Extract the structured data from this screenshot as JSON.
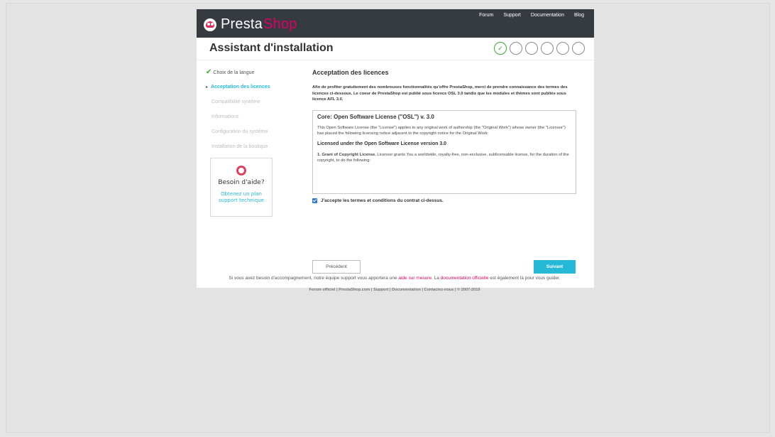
{
  "brand": {
    "presta": "Presta",
    "shop": "Shop"
  },
  "toplinks": [
    "Forum",
    "Support",
    "Documentation",
    "Blog"
  ],
  "page_title": "Assistant d'installation",
  "steps_total": 6,
  "steps_done": 1,
  "sidebar": {
    "items": [
      {
        "label": "Choix de la langue",
        "state": "done"
      },
      {
        "label": "Acceptation des licences",
        "state": "active"
      },
      {
        "label": "Compatibilité système",
        "state": "pending"
      },
      {
        "label": "Informations",
        "state": "pending"
      },
      {
        "label": "Configuration du système",
        "state": "pending"
      },
      {
        "label": "Installation de la boutique",
        "state": "pending"
      }
    ]
  },
  "help": {
    "heading": "Besoin d'aide?",
    "link": "Obtenez un plan support technique"
  },
  "main": {
    "heading": "Acceptation des licences",
    "intro": "Afin de profiter gratuitement des nombreuses fonctionnalités qu'offre PrestaShop, merci de prendre connaissance des termes des licences ci-dessous. Le coeur de PrestaShop est publié sous licence OSL 3.0 tandis que les modules et thèmes sont publiés sous licence AFL 3.0."
  },
  "license": {
    "title": "Core: Open Software License (\"OSL\") v. 3.0",
    "para1": "This Open Software License (the \"License\") applies to any original work of authorship (the \"Original Work\") whose owner (the \"Licensor\") has placed the following licensing notice adjacent to the copyright notice for the Original Work:",
    "subhead": "Licensed under the Open Software License version 3.0",
    "grant_strong": "1. Grant of Copyright License.",
    "grant_text": " Licensor grants You a worldwide, royalty-free, non-exclusive, sublicensable license, for the duration of the copyright, to do the following:"
  },
  "accept_label": "J'accepte les termes et conditions du contrat ci-dessus.",
  "accept_checked": true,
  "buttons": {
    "prev": "Précédent",
    "next": "Suivant"
  },
  "assist": {
    "before": "Si vous avez besoin d'accompagnement, notre équipe support vous apportera une ",
    "link1": "aide sur mesure",
    "middle": ". La ",
    "link2": "documentation officielle",
    "after": " est également là pour vous guider."
  },
  "footer": "Forum officiel | PrestaShop.com | Support | Documentation | Contactez-nous | © 2007-2019"
}
